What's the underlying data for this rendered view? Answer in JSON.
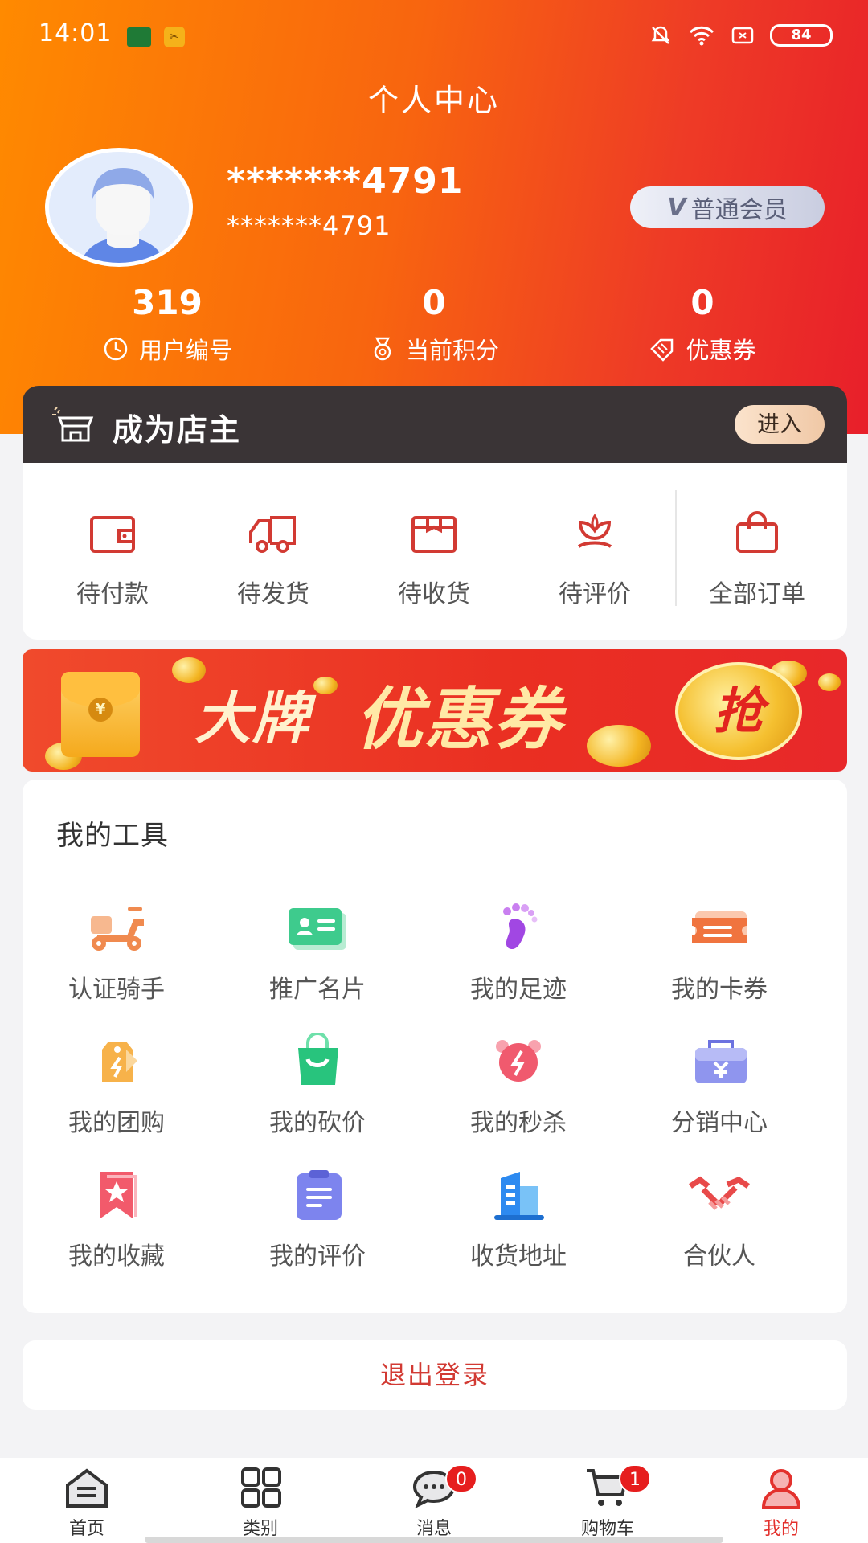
{
  "status_bar": {
    "time": "14:01",
    "battery": "84"
  },
  "header": {
    "title": "个人中心"
  },
  "profile": {
    "username": "*******4791",
    "phone": "*******4791",
    "member_level": "普通会员",
    "member_mark": "V"
  },
  "stats": [
    {
      "value": "319",
      "label": "用户编号",
      "icon": "clock-icon"
    },
    {
      "value": "0",
      "label": "当前积分",
      "icon": "medal-icon"
    },
    {
      "value": "0",
      "label": "优惠券",
      "icon": "coupon-icon"
    }
  ],
  "shop_owner": {
    "title": "成为店主",
    "enter": "进入"
  },
  "orders": [
    {
      "label": "待付款",
      "icon": "wallet-icon"
    },
    {
      "label": "待发货",
      "icon": "truck-icon"
    },
    {
      "label": "待收货",
      "icon": "package-icon"
    },
    {
      "label": "待评价",
      "icon": "flower-icon"
    },
    {
      "label": "全部订单",
      "icon": "shopping-bag-icon"
    }
  ],
  "banner": {
    "text1": "大牌",
    "text2": "优惠券",
    "grab": "抢",
    "yen": "¥"
  },
  "tools": {
    "title": "我的工具",
    "items": [
      {
        "label": "认证骑手",
        "icon": "scooter-icon"
      },
      {
        "label": "推广名片",
        "icon": "id-card-icon"
      },
      {
        "label": "我的足迹",
        "icon": "footprint-icon"
      },
      {
        "label": "我的卡券",
        "icon": "ticket-icon"
      },
      {
        "label": "我的团购",
        "icon": "price-tag-icon"
      },
      {
        "label": "我的砍价",
        "icon": "shopping-bag-icon"
      },
      {
        "label": "我的秒杀",
        "icon": "alarm-clock-icon"
      },
      {
        "label": "分销中心",
        "icon": "cash-box-icon"
      },
      {
        "label": "我的收藏",
        "icon": "bookmark-star-icon"
      },
      {
        "label": "我的评价",
        "icon": "clipboard-icon"
      },
      {
        "label": "收货地址",
        "icon": "building-icon"
      },
      {
        "label": "合伙人",
        "icon": "handshake-icon"
      }
    ]
  },
  "logout": "退出登录",
  "tabbar": [
    {
      "label": "首页",
      "icon": "home-icon"
    },
    {
      "label": "类别",
      "icon": "grid-icon"
    },
    {
      "label": "消息",
      "icon": "chat-icon",
      "badge": "0"
    },
    {
      "label": "购物车",
      "icon": "cart-icon",
      "badge": "1"
    },
    {
      "label": "我的",
      "icon": "user-icon",
      "active": true
    }
  ],
  "colors": {
    "accent": "#e3312d",
    "header_start": "#ff8a00",
    "header_end": "#e81f2a",
    "shop_bar": "#3a3436"
  }
}
